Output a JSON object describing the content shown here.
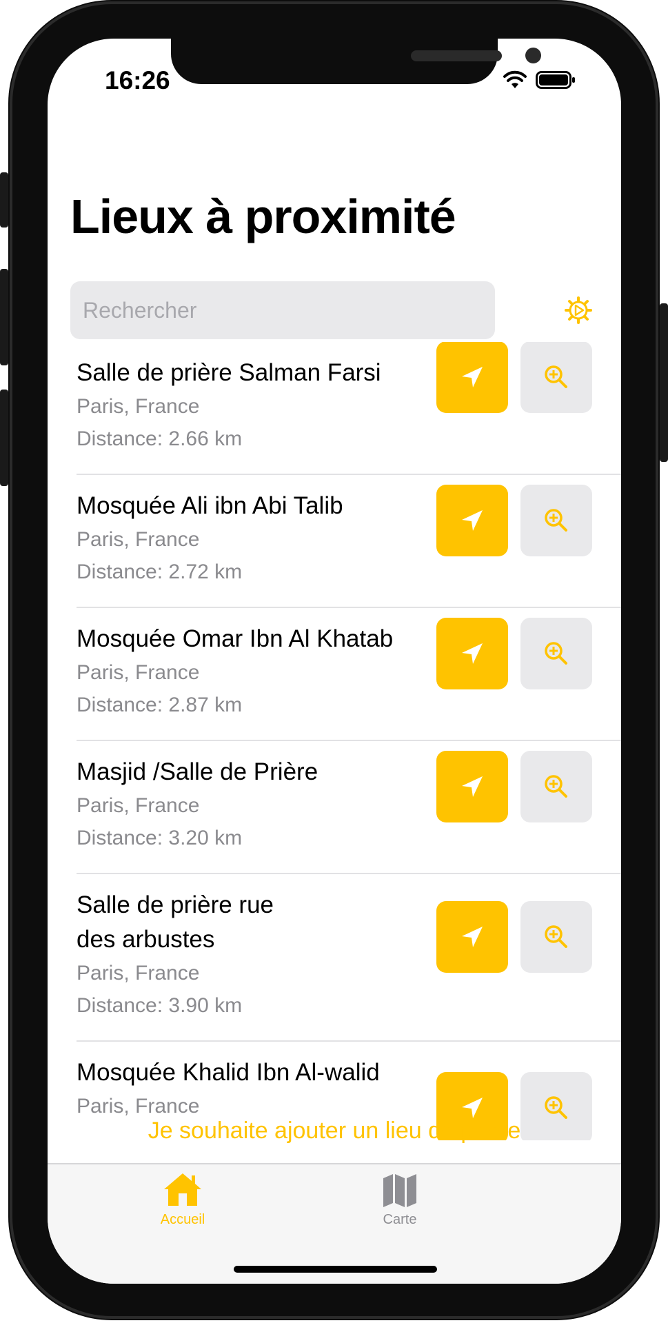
{
  "status_bar": {
    "time": "16:26"
  },
  "header": {
    "title": "Lieux à proximité"
  },
  "search": {
    "placeholder": "Rechercher"
  },
  "places": [
    {
      "name": "Salle de prière Salman Farsi",
      "location": "Paris, France",
      "distance": "Distance: 2.66 km"
    },
    {
      "name": "Mosquée Ali ibn Abi Talib",
      "location": "Paris, France",
      "distance": "Distance: 2.72 km"
    },
    {
      "name": "Mosquée Omar Ibn Al Khatab",
      "location": "Paris, France",
      "distance": "Distance: 2.87 km"
    },
    {
      "name": "Masjid /Salle de Prière",
      "location": "Paris, France",
      "distance": "Distance: 3.20 km"
    },
    {
      "name": "Salle de prière rue des arbustes",
      "location": "Paris, France",
      "distance": "Distance: 3.90 km"
    },
    {
      "name": "Mosquée Khalid Ibn Al-walid",
      "location": "Paris, France",
      "distance": ""
    }
  ],
  "add_place_link": "Je souhaite ajouter un lieu de prière",
  "tabs": [
    {
      "label": "Accueil",
      "icon": "house-icon",
      "active": true
    },
    {
      "label": "Carte",
      "icon": "map-icon",
      "active": false
    }
  ],
  "colors": {
    "accent": "#ffc300",
    "inactive": "#8e8e93",
    "secondary_bg": "#e9e9eb"
  }
}
